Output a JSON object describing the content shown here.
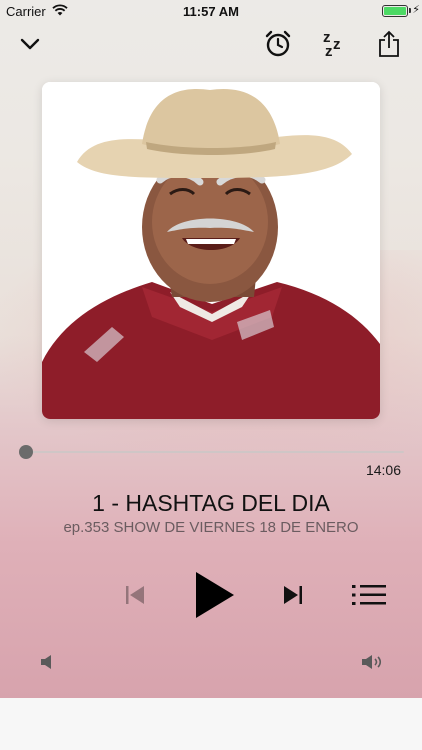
{
  "status_bar": {
    "carrier": "Carrier",
    "time": "11:57 AM",
    "battery_level": 1.0
  },
  "toolbar": {
    "icons": [
      "chevron-down-icon",
      "alarm-clock-icon",
      "sleep-zzz-icon",
      "share-icon"
    ]
  },
  "artwork": {
    "description_icon": "podcast-artwork"
  },
  "player": {
    "progress": 0.0,
    "duration": "14:06",
    "title": "1 - HASHTAG DEL DIA",
    "subtitle": "ep.353 SHOW DE VIERNES 18 DE ENERO"
  },
  "colors": {
    "accent": "#000000",
    "progress_thumb": "#6b6b6b",
    "subtitle": "#6b5c60"
  }
}
